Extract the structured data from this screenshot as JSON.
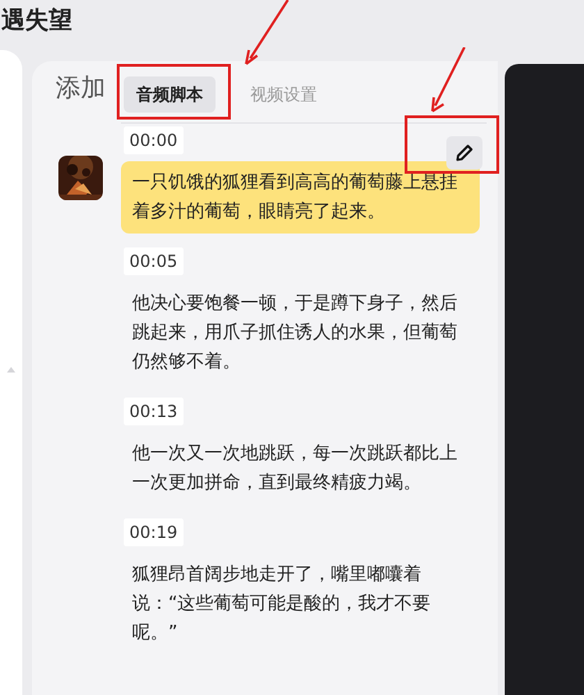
{
  "page_title": "遇失望",
  "panel": {
    "heading": "添加",
    "tabs": [
      {
        "label": "音频脚本",
        "selected": true
      },
      {
        "label": "视频设置",
        "selected": false
      }
    ],
    "segments": [
      {
        "time": "00:00",
        "text": "一只饥饿的狐狸看到高高的葡萄藤上悬挂着多汁的葡萄，眼睛亮了起来。",
        "selected": true
      },
      {
        "time": "00:05",
        "text": "他决心要饱餐一顿，于是蹲下身子，然后跳起来，用爪子抓住诱人的水果，但葡萄仍然够不着。",
        "selected": false
      },
      {
        "time": "00:13",
        "text": "他一次又一次地跳跃，每一次跳跃都比上一次更加拼命，直到最终精疲力竭。",
        "selected": false
      },
      {
        "time": "00:19",
        "text": "狐狸昂首阔步地走开了，嘴里嘟囔着说：“这些葡萄可能是酸的，我才不要呢。”",
        "selected": false
      }
    ]
  }
}
